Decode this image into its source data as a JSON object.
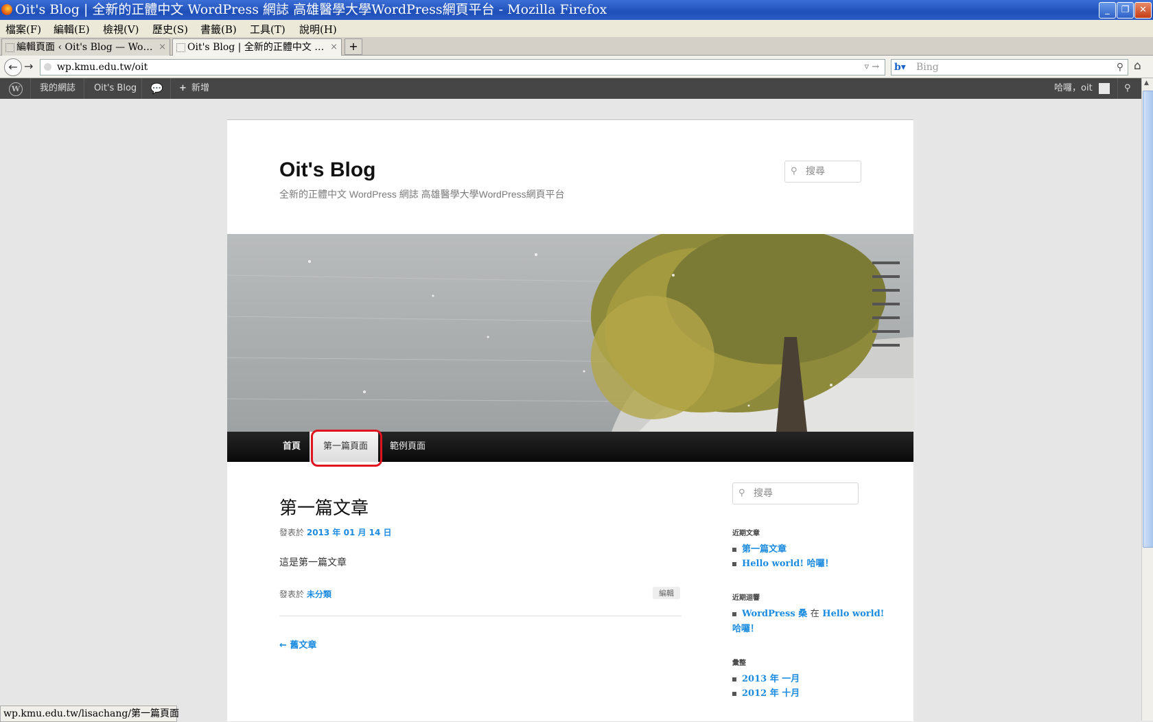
{
  "window": {
    "title": "Oit's Blog | 全新的正體中文 WordPress 網誌 高雄醫學大學WordPress網頁平台 - Mozilla Firefox"
  },
  "menubar": [
    "檔案(F)",
    "編輯(E)",
    "檢視(V)",
    "歷史(S)",
    "書籤(B)",
    "工具(T)",
    "說明(H)"
  ],
  "tabs": [
    {
      "label": "編輯頁面 ‹ Oit's Blog — Wo…",
      "active": false
    },
    {
      "label": "Oit's Blog | 全新的正體中文 …",
      "active": true
    }
  ],
  "nav": {
    "url": "wp.kmu.edu.tw/oit",
    "search_placeholder": "Bing"
  },
  "adminbar": {
    "my_sites": "我的網誌",
    "blog": "Oit's Blog",
    "new": "新增",
    "greeting": "哈囉，oit"
  },
  "blog": {
    "title": "Oit's Blog",
    "description": "全新的正體中文 WordPress 網誌 高雄醫學大學WordPress網頁平台",
    "search_placeholder": "搜尋"
  },
  "menu": [
    "首頁",
    "第一篇頁面",
    "範例頁面"
  ],
  "post": {
    "title": "第一篇文章",
    "posted_on_label": "發表於",
    "date": "2013 年 01 月 14 日",
    "body": "這是第一篇文章",
    "category_label": "發表於",
    "category": "未分類",
    "edit": "編輯",
    "older": "← 舊文章"
  },
  "sidebar": {
    "search_placeholder": "搜尋",
    "recent_posts_title": "近期文章",
    "recent_posts": [
      "第一篇文章",
      "Hello world! 哈囉！"
    ],
    "recent_comments_title": "近期迴響",
    "comment": {
      "author": "WordPress 桑",
      "on": "在",
      "post_line1": "Hello world!",
      "post_line2": "哈囉！"
    },
    "archives_title": "彙整",
    "archives": [
      "2013 年 一月",
      "2012 年 十月"
    ]
  },
  "status": "wp.kmu.edu.tw/lisachang/第一篇頁面"
}
